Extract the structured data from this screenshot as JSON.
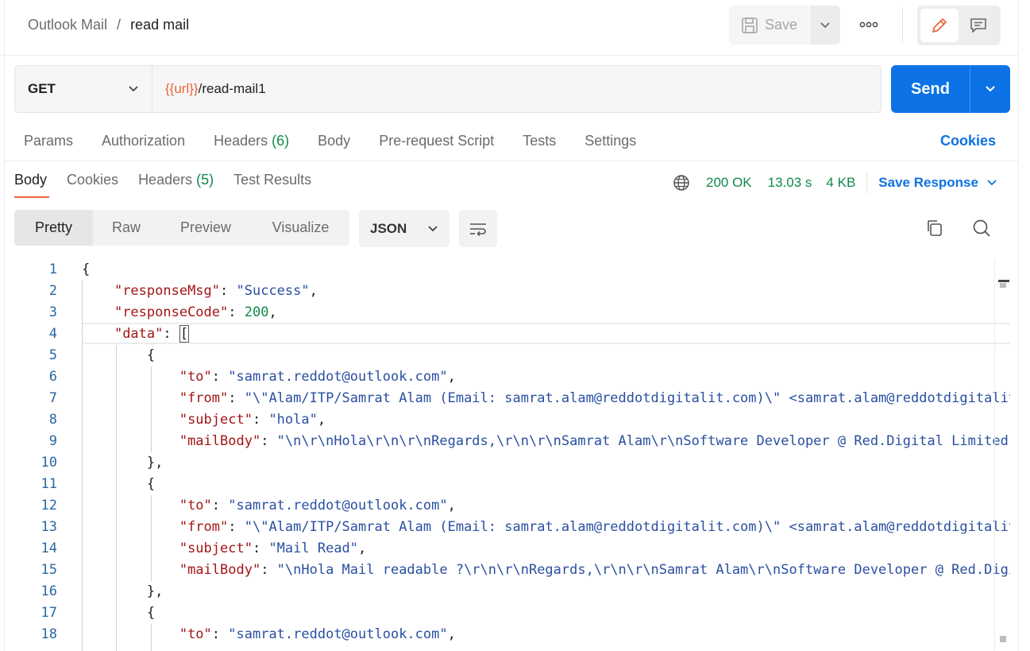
{
  "breadcrumb": {
    "parent": "Outlook Mail",
    "separator": "/",
    "current": "read mail"
  },
  "toolbar": {
    "save_label": "Save"
  },
  "request": {
    "method": "GET",
    "url_variable": "{{url}}",
    "url_path": "/read-mail1",
    "send_label": "Send"
  },
  "request_tabs": {
    "params": "Params",
    "authorization": "Authorization",
    "headers": "Headers",
    "headers_count": "(6)",
    "body": "Body",
    "prerequest": "Pre-request Script",
    "tests": "Tests",
    "settings": "Settings",
    "cookies_link": "Cookies"
  },
  "response_tabs": {
    "body": "Body",
    "cookies": "Cookies",
    "headers": "Headers",
    "headers_count": "(5)",
    "test_results": "Test Results"
  },
  "status": {
    "code": "200 OK",
    "time": "13.03 s",
    "size": "4 KB",
    "save_response": "Save Response"
  },
  "view_tabs": {
    "pretty": "Pretty",
    "raw": "Raw",
    "preview": "Preview",
    "visualize": "Visualize"
  },
  "format": "JSON",
  "colors": {
    "accent": "#0c72e5",
    "status": "#0f8a4b",
    "variable": "#e8653b",
    "json_key": "#a31515",
    "json_string": "#2a4fa0"
  },
  "code": {
    "l1": "{",
    "l2_key": "\"responseMsg\"",
    "l2_val": "\"Success\"",
    "l3_key": "\"responseCode\"",
    "l3_val": "200",
    "l4_key": "\"data\"",
    "l4_val": "[",
    "open_brace": "{",
    "close_brace": "},",
    "to_key": "\"to\"",
    "to_val": "\"samrat.reddot@outlook.com\"",
    "from_key": "\"from\"",
    "from_val": "\"\\\"Alam/ITP/Samrat Alam (Email: samrat.alam@reddotdigitalit.com)\\\" <samrat.alam@reddotdigitalit.com>\"",
    "subject_key": "\"subject\"",
    "l8_val": "\"hola\"",
    "mailbody_key": "\"mailBody\"",
    "l9_val": "\"\\n\\r\\nHola\\r\\n\\r\\nRegards,\\r\\n\\r\\nSamrat Alam\\r\\nSoftware Developer @ Red.Digital Limited\"",
    "l14_val": "\"Mail Read\"",
    "l15_val": "\"\\nHola Mail readable ?\\r\\n\\r\\nRegards,\\r\\n\\r\\nSamrat Alam\\r\\nSoftware Developer @ Red.Digital Limited\""
  }
}
